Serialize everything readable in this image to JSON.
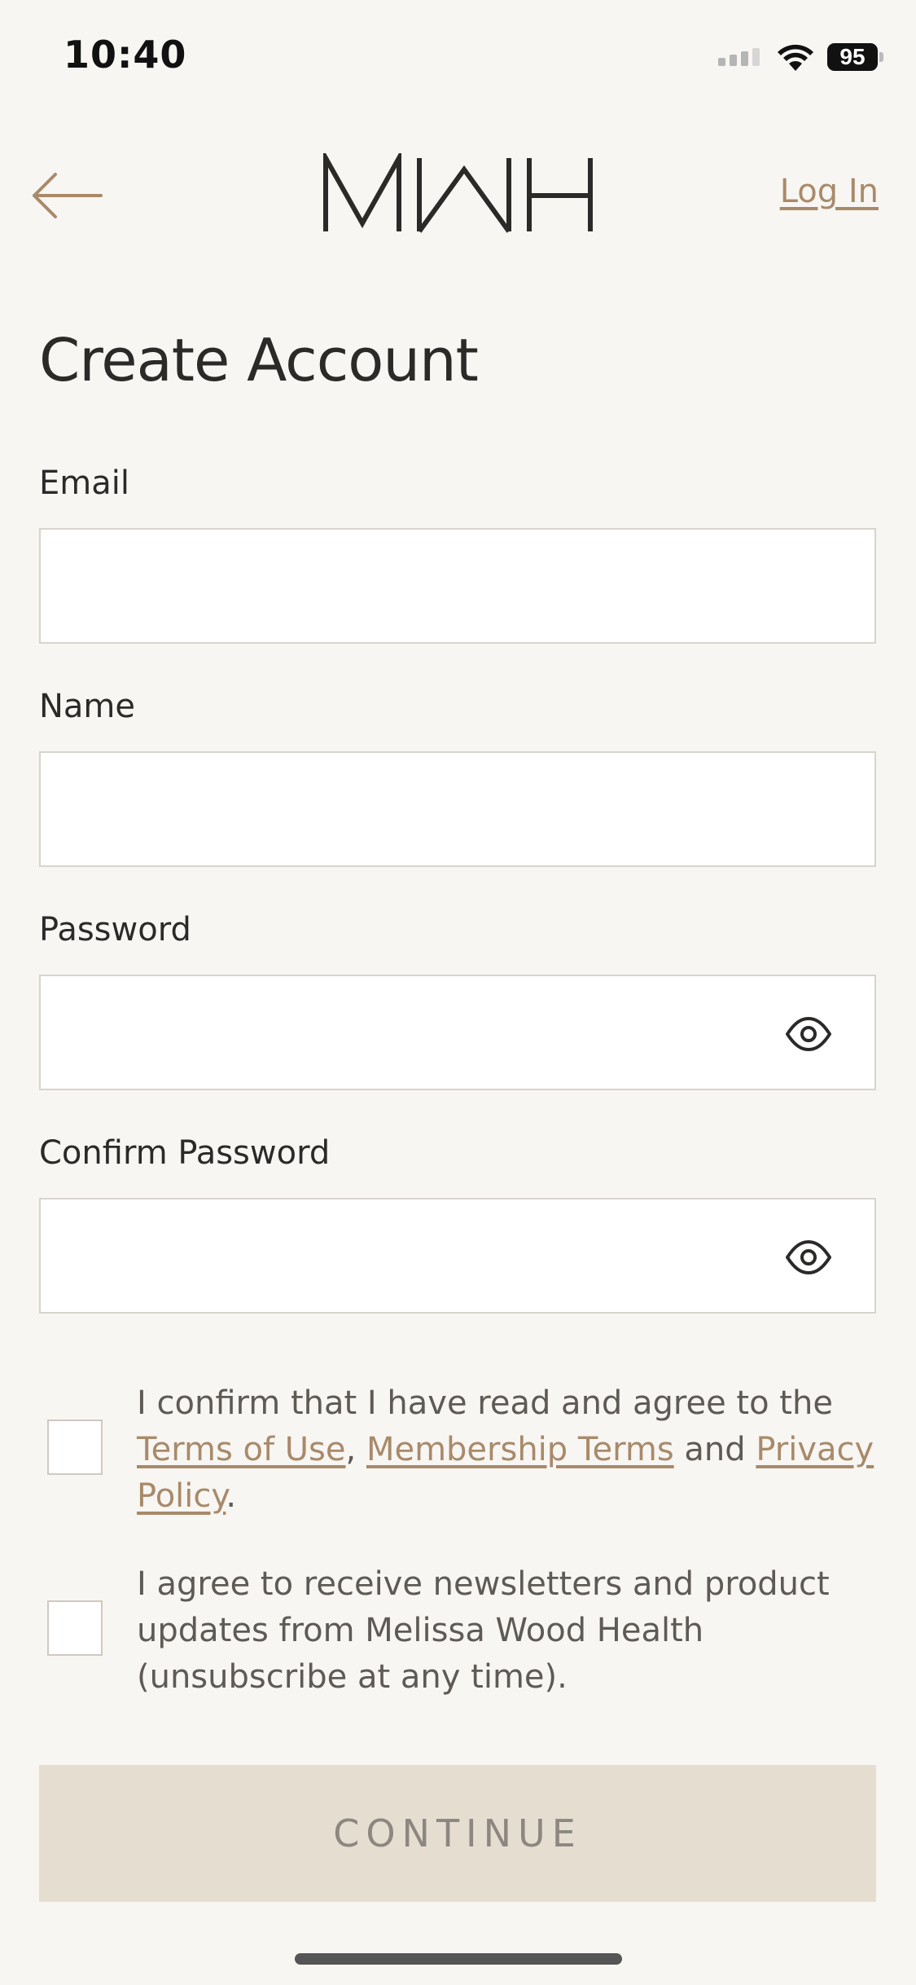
{
  "status_bar": {
    "time": "10:40",
    "battery": "95"
  },
  "header": {
    "logo_text": "MWH",
    "login_label": "Log In"
  },
  "page": {
    "title": "Create Account"
  },
  "form": {
    "email_label": "Email",
    "name_label": "Name",
    "password_label": "Password",
    "confirm_password_label": "Confirm Password"
  },
  "consent": {
    "terms_prefix": "I confirm that I have read and agree to the ",
    "terms_of_use": "Terms of Use",
    "comma": ", ",
    "membership_terms": "Membership Terms",
    "and": " and ",
    "privacy_policy": "Privacy Policy",
    "period": ".",
    "newsletter": "I agree to receive newsletters and product updates from Melissa Wood Health (unsubscribe at any time)."
  },
  "actions": {
    "continue_label": "CONTINUE"
  },
  "colors": {
    "background": "#f8f6f3",
    "accent": "#a88a6a",
    "button_disabled": "#e6ddd1"
  }
}
